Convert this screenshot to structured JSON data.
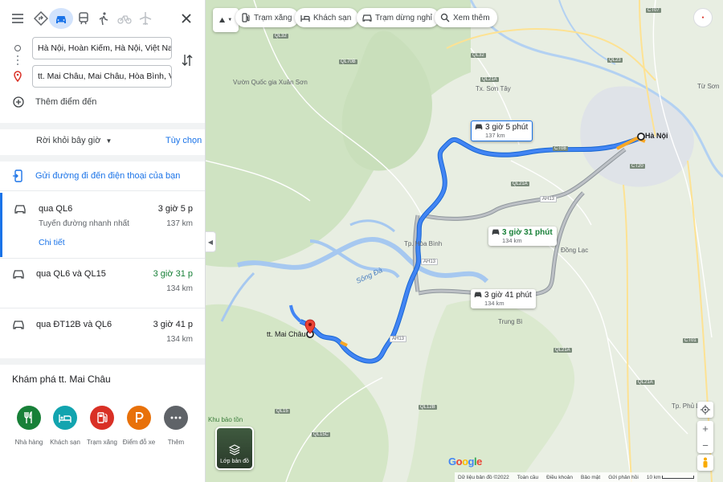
{
  "panel": {
    "origin_value": "Hà Nội, Hoàn Kiếm, Hà Nội, Việt Nam",
    "destination_value": "tt. Mai Châu, Mai Châu, Hòa Bình, Việt Nam",
    "add_destination_label": "Thêm điểm đến",
    "leave_now_label": "Rời khỏi bây giờ",
    "options_label": "Tùy chọn",
    "send_to_phone_label": "Gửi đường đi đến điện thoại của bạn",
    "routes": [
      {
        "name": "qua QL6",
        "time": "3 giờ 5 p",
        "subtitle": "Tuyến đường nhanh nhất",
        "distance": "137 km",
        "detail_link": "Chi tiết",
        "selected": true
      },
      {
        "name": "qua QL6 và QL15",
        "time": "3 giờ 31 p",
        "distance": "134 km",
        "time_color": "green"
      },
      {
        "name": "qua ĐT12B và QL6",
        "time": "3 giờ 41 p",
        "distance": "134 km"
      }
    ],
    "explore_title": "Khám phá tt. Mai Châu",
    "categories": [
      {
        "label": "Nhà hàng",
        "color": "#188038",
        "icon": "fork-knife-icon"
      },
      {
        "label": "Khách sạn",
        "color": "#12a4af",
        "icon": "bed-icon"
      },
      {
        "label": "Trạm xăng",
        "color": "#d93025",
        "icon": "gas-pump-icon"
      },
      {
        "label": "Điểm đỗ xe",
        "color": "#e8710a",
        "icon": "parking-icon"
      },
      {
        "label": "Thêm",
        "color": "#5f6368",
        "icon": "more-icon"
      }
    ]
  },
  "map": {
    "chips": [
      "Trạm xăng",
      "Khách sạn",
      "Trạm dừng nghỉ",
      "Xem thêm"
    ],
    "route_labels": [
      {
        "time": "3 giờ 5 phút",
        "distance": "137 km"
      },
      {
        "time": "3 giờ 31 phút",
        "distance": "134 km"
      },
      {
        "time": "3 giờ 41 phút",
        "distance": "134 km"
      }
    ],
    "places": {
      "hanoi": "Hà Nội",
      "maichau": "tt. Mai Châu",
      "hoabinh": "Tp. Hòa Bình",
      "dongLac": "Đồng Lạc",
      "trungBi": "Trung Bì",
      "tuSon": "Từ Sơn",
      "phuLy": "Tp. Phủ Lý",
      "tuanChau": "Tx. Sơn Tây",
      "songDa": "Sông Đà",
      "xuanSon": "Vườn Quốc gia Xuân Sơn",
      "khuBao": "Khu bảo tồn"
    },
    "layers_label": "Lớp bản đồ",
    "logo": "Google",
    "footer": [
      "Dữ liệu bản đồ ©2022",
      "Toàn cầu",
      "Điều khoản",
      "Bảo mật",
      "Gửi phản hồi",
      "10 km"
    ]
  },
  "colors": {
    "accent": "#1a73e8",
    "route_primary": "#1a73e8",
    "route_alt": "#9aa0a6",
    "eta_green": "#188038"
  }
}
